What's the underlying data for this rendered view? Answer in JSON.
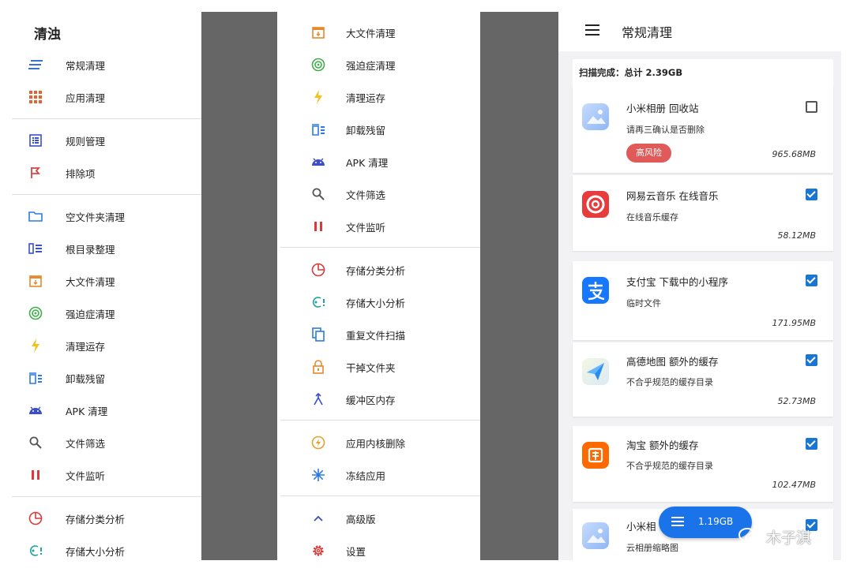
{
  "panel1": {
    "title": "清浊",
    "items": [
      {
        "label": "常规清理",
        "icon": "stack-lines-icon"
      },
      {
        "label": "应用清理",
        "icon": "grid-apps-icon"
      },
      {
        "label": "规则管理",
        "icon": "list-box-icon"
      },
      {
        "label": "排除项",
        "icon": "flag-icon"
      },
      {
        "label": "空文件夹清理",
        "icon": "folder-icon"
      },
      {
        "label": "根目录整理",
        "icon": "root-tree-icon"
      },
      {
        "label": "大文件清理",
        "icon": "big-file-icon"
      },
      {
        "label": "强迫症清理",
        "icon": "target-icon"
      },
      {
        "label": "清理运存",
        "icon": "bolt-icon"
      },
      {
        "label": "卸载残留",
        "icon": "trash-lines-icon"
      },
      {
        "label": "APK 清理",
        "icon": "android-icon"
      },
      {
        "label": "文件筛选",
        "icon": "search-icon"
      },
      {
        "label": "文件监听",
        "icon": "pause-icon"
      },
      {
        "label": "存储分类分析",
        "icon": "pie-icon"
      },
      {
        "label": "存储大小分析",
        "icon": "size-analyze-icon"
      }
    ]
  },
  "panel2": {
    "items": [
      {
        "label": "大文件清理",
        "icon": "big-file-icon"
      },
      {
        "label": "强迫症清理",
        "icon": "target-icon"
      },
      {
        "label": "清理运存",
        "icon": "bolt-icon"
      },
      {
        "label": "卸载残留",
        "icon": "trash-lines-icon"
      },
      {
        "label": "APK 清理",
        "icon": "android-icon"
      },
      {
        "label": "文件筛选",
        "icon": "search-icon"
      },
      {
        "label": "文件监听",
        "icon": "pause-icon"
      },
      {
        "label": "存储分类分析",
        "icon": "pie-icon"
      },
      {
        "label": "存储大小分析",
        "icon": "size-analyze-icon"
      },
      {
        "label": "重复文件扫描",
        "icon": "duplicate-icon"
      },
      {
        "label": "干掉文件夹",
        "icon": "lock-icon"
      },
      {
        "label": "缓冲区内存",
        "icon": "merge-icon"
      },
      {
        "label": "应用内核删除",
        "icon": "flash-circle-icon"
      },
      {
        "label": "冻结应用",
        "icon": "snowflake-icon"
      },
      {
        "label": "高级版",
        "icon": "chevron-up-icon"
      },
      {
        "label": "设置",
        "icon": "gear-icon"
      }
    ]
  },
  "panel3": {
    "title": "常规清理",
    "summary": "扫描完成：总计 2.39GB",
    "cards": [
      {
        "title": "小米相册 回收站",
        "subtitle": "请再三确认是否删除",
        "size": "965.68MB",
        "checked": false,
        "badge": "高风险",
        "icon": "gallery-app-icon"
      },
      {
        "title": "网易云音乐 在线音乐",
        "subtitle": "在线音乐缓存",
        "size": "58.12MB",
        "checked": true,
        "icon": "netease-music-icon"
      },
      {
        "title": "支付宝 下载中的小程序",
        "subtitle": "临时文件",
        "size": "171.95MB",
        "checked": true,
        "icon": "alipay-icon"
      },
      {
        "title": "高德地图 额外的缓存",
        "subtitle": "不合乎规范的缓存目录",
        "size": "52.73MB",
        "checked": true,
        "icon": "amap-icon"
      },
      {
        "title": "淘宝 额外的缓存",
        "subtitle": "不合乎规范的缓存目录",
        "size": "102.47MB",
        "checked": true,
        "icon": "taobao-icon"
      },
      {
        "title": "小米相",
        "subtitle": "云相册缩略图",
        "checked": true,
        "icon": "gallery-app-icon"
      }
    ],
    "fab_label": "1.19GB",
    "watermark": "木子淇"
  }
}
